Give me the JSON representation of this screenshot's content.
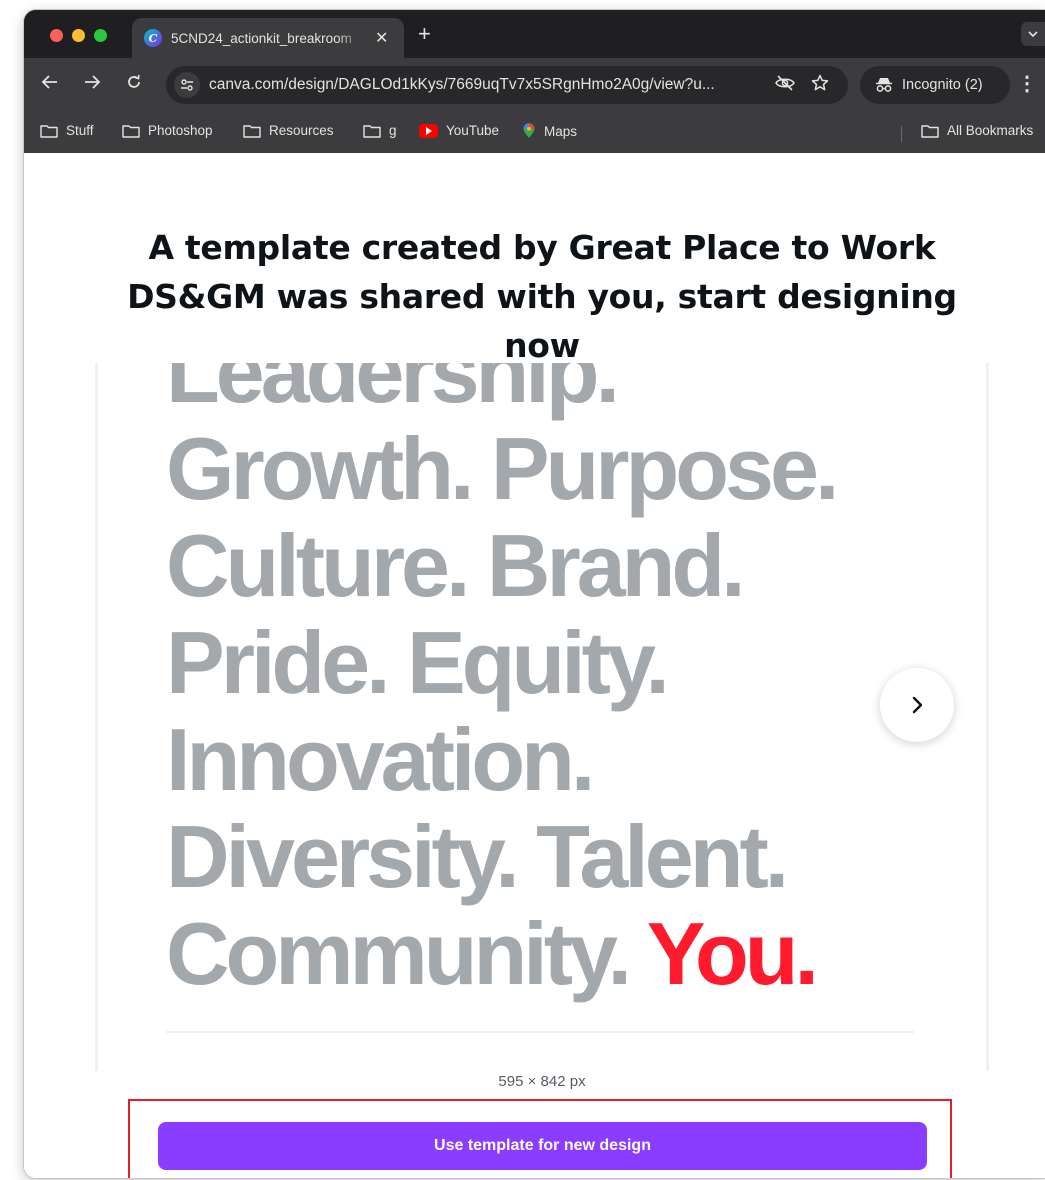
{
  "browser": {
    "tab_title": "5CND24_actionkit_breakroom",
    "tab_close": "✕",
    "new_tab": "+",
    "url": "canva.com/design/DAGLOd1kKys/7669uqTv7x5SRgnHmo2A0g/view?u...",
    "incognito_label": "Incognito (2)",
    "bookmarks": [
      "Stuff",
      "Photoshop",
      "Resources",
      "g",
      "YouTube",
      "Maps"
    ],
    "all_bookmarks": "All Bookmarks"
  },
  "page": {
    "heading": "A template created by Great Place to Work DS&GM was shared with you, start designing now",
    "poster_lines": {
      "l0": "Leadership.",
      "l1": "Growth. Purpose.",
      "l2": "Culture. Brand.",
      "l3": "Pride. Equity.",
      "l4": "Innovation.",
      "l5": "Diversity. Talent.",
      "l6_prefix": "Community. ",
      "l6_accent": "You."
    },
    "size_label": "595 × 842 px",
    "cta_label": "Use template for new design"
  },
  "icons": {
    "back": "arrow-left-icon",
    "forward": "arrow-right-icon",
    "reload": "reload-icon",
    "site_info": "tune-icon",
    "eye_off": "eye-off-icon",
    "bookmark_star": "star-icon",
    "incognito": "incognito-icon",
    "menu": "kebab-menu-icon",
    "next": "chevron-right-icon"
  },
  "colors": {
    "poster_text": "#a3a8ad",
    "accent_red": "#ff1a2d",
    "cta_purple": "#8b3dff",
    "highlight": "#e2202c"
  }
}
